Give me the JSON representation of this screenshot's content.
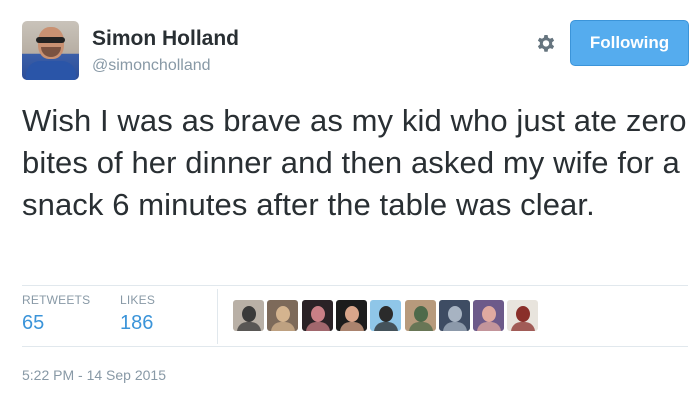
{
  "user": {
    "display_name": "Simon Holland",
    "screen_name": "@simoncholland",
    "avatar_icon": "profile-photo"
  },
  "actions": {
    "settings_icon": "gear-icon",
    "follow_label": "Following",
    "follow_color": "#55acee"
  },
  "tweet": {
    "text": "Wish I was as brave as my kid who just ate zero bites of her dinner and then asked my wife for a snack 6 minutes after the table was clear."
  },
  "stats": {
    "retweets_label": "RETWEETS",
    "retweets_count": "65",
    "likes_label": "LIKES",
    "likes_count": "186"
  },
  "likers": [
    {
      "icon": "liker-avatar-1",
      "colors": [
        "#b9b0a6",
        "#3a3a3a"
      ]
    },
    {
      "icon": "liker-avatar-2",
      "colors": [
        "#7d6a5a",
        "#d4b48f"
      ]
    },
    {
      "icon": "liker-avatar-3",
      "colors": [
        "#2a2226",
        "#c97f86"
      ]
    },
    {
      "icon": "liker-avatar-4",
      "colors": [
        "#1c1c1c",
        "#d9a58a"
      ]
    },
    {
      "icon": "liker-avatar-5",
      "colors": [
        "#8fc6e8",
        "#2b2b2b"
      ]
    },
    {
      "icon": "liker-avatar-6",
      "colors": [
        "#b79a7c",
        "#4d6a4a"
      ]
    },
    {
      "icon": "liker-avatar-7",
      "colors": [
        "#3e4c63",
        "#a7b3c2"
      ]
    },
    {
      "icon": "liker-avatar-8",
      "colors": [
        "#6d5a8a",
        "#e0a9a0"
      ]
    },
    {
      "icon": "liker-avatar-9",
      "colors": [
        "#e8e4dd",
        "#8a2f2a"
      ]
    }
  ],
  "meta": {
    "timestamp": "5:22 PM - 14 Sep 2015"
  }
}
